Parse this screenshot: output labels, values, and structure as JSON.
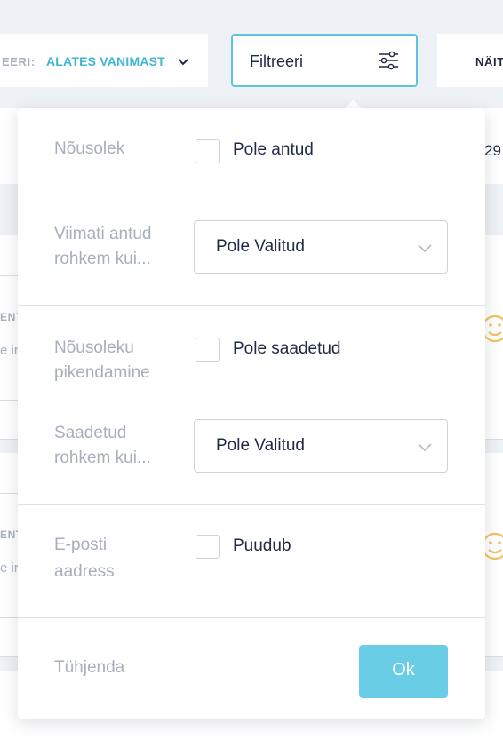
{
  "toolbar": {
    "sort_label": "EERI:",
    "sort_value": "ALATES VANIMAST",
    "filter_label": "Filtreeri",
    "show_label": "NÄIT"
  },
  "background": {
    "row_number": "29",
    "row_labels": [
      "ENT",
      "ENT"
    ],
    "row_snippets": [
      "e ir",
      "e ir"
    ]
  },
  "filter": {
    "consent": {
      "label": "Nõusolek",
      "checkbox_label": "Pole antud",
      "checked": false
    },
    "last_given": {
      "label_line1": "Viimati antud",
      "label_line2": "rohkem kui...",
      "selected": "Pole Valitud"
    },
    "extension": {
      "label_line1": "Nõusoleku",
      "label_line2": "pikendamine",
      "checkbox_label": "Pole saadetud",
      "checked": false
    },
    "sent": {
      "label_line1": "Saadetud",
      "label_line2": "rohkem kui...",
      "selected": "Pole Valitud"
    },
    "email": {
      "label_line1": "E-posti",
      "label_line2": "aadress",
      "checkbox_label": "Puudub",
      "checked": false
    },
    "clear_label": "Tühjenda",
    "ok_label": "Ok"
  },
  "colors": {
    "accent": "#5cc6e0",
    "ok_button": "#6acde6",
    "label_gray": "#a7afbb",
    "text_dark": "#1f2a44",
    "smiley": "#f2c260"
  }
}
